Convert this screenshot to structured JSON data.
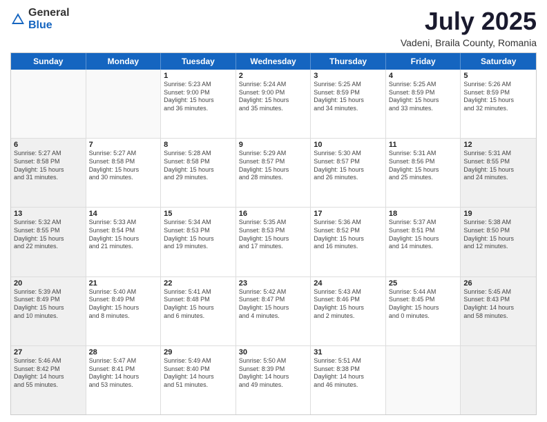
{
  "logo": {
    "general": "General",
    "blue": "Blue"
  },
  "title": "July 2025",
  "subtitle": "Vadeni, Braila County, Romania",
  "header_days": [
    "Sunday",
    "Monday",
    "Tuesday",
    "Wednesday",
    "Thursday",
    "Friday",
    "Saturday"
  ],
  "rows": [
    [
      {
        "day": "",
        "lines": [],
        "empty": true
      },
      {
        "day": "",
        "lines": [],
        "empty": true
      },
      {
        "day": "1",
        "lines": [
          "Sunrise: 5:23 AM",
          "Sunset: 9:00 PM",
          "Daylight: 15 hours",
          "and 36 minutes."
        ]
      },
      {
        "day": "2",
        "lines": [
          "Sunrise: 5:24 AM",
          "Sunset: 9:00 PM",
          "Daylight: 15 hours",
          "and 35 minutes."
        ]
      },
      {
        "day": "3",
        "lines": [
          "Sunrise: 5:25 AM",
          "Sunset: 8:59 PM",
          "Daylight: 15 hours",
          "and 34 minutes."
        ]
      },
      {
        "day": "4",
        "lines": [
          "Sunrise: 5:25 AM",
          "Sunset: 8:59 PM",
          "Daylight: 15 hours",
          "and 33 minutes."
        ]
      },
      {
        "day": "5",
        "lines": [
          "Sunrise: 5:26 AM",
          "Sunset: 8:59 PM",
          "Daylight: 15 hours",
          "and 32 minutes."
        ]
      }
    ],
    [
      {
        "day": "6",
        "lines": [
          "Sunrise: 5:27 AM",
          "Sunset: 8:58 PM",
          "Daylight: 15 hours",
          "and 31 minutes."
        ],
        "shaded": true
      },
      {
        "day": "7",
        "lines": [
          "Sunrise: 5:27 AM",
          "Sunset: 8:58 PM",
          "Daylight: 15 hours",
          "and 30 minutes."
        ]
      },
      {
        "day": "8",
        "lines": [
          "Sunrise: 5:28 AM",
          "Sunset: 8:58 PM",
          "Daylight: 15 hours",
          "and 29 minutes."
        ]
      },
      {
        "day": "9",
        "lines": [
          "Sunrise: 5:29 AM",
          "Sunset: 8:57 PM",
          "Daylight: 15 hours",
          "and 28 minutes."
        ]
      },
      {
        "day": "10",
        "lines": [
          "Sunrise: 5:30 AM",
          "Sunset: 8:57 PM",
          "Daylight: 15 hours",
          "and 26 minutes."
        ]
      },
      {
        "day": "11",
        "lines": [
          "Sunrise: 5:31 AM",
          "Sunset: 8:56 PM",
          "Daylight: 15 hours",
          "and 25 minutes."
        ]
      },
      {
        "day": "12",
        "lines": [
          "Sunrise: 5:31 AM",
          "Sunset: 8:55 PM",
          "Daylight: 15 hours",
          "and 24 minutes."
        ],
        "shaded": true
      }
    ],
    [
      {
        "day": "13",
        "lines": [
          "Sunrise: 5:32 AM",
          "Sunset: 8:55 PM",
          "Daylight: 15 hours",
          "and 22 minutes."
        ],
        "shaded": true
      },
      {
        "day": "14",
        "lines": [
          "Sunrise: 5:33 AM",
          "Sunset: 8:54 PM",
          "Daylight: 15 hours",
          "and 21 minutes."
        ]
      },
      {
        "day": "15",
        "lines": [
          "Sunrise: 5:34 AM",
          "Sunset: 8:53 PM",
          "Daylight: 15 hours",
          "and 19 minutes."
        ]
      },
      {
        "day": "16",
        "lines": [
          "Sunrise: 5:35 AM",
          "Sunset: 8:53 PM",
          "Daylight: 15 hours",
          "and 17 minutes."
        ]
      },
      {
        "day": "17",
        "lines": [
          "Sunrise: 5:36 AM",
          "Sunset: 8:52 PM",
          "Daylight: 15 hours",
          "and 16 minutes."
        ]
      },
      {
        "day": "18",
        "lines": [
          "Sunrise: 5:37 AM",
          "Sunset: 8:51 PM",
          "Daylight: 15 hours",
          "and 14 minutes."
        ]
      },
      {
        "day": "19",
        "lines": [
          "Sunrise: 5:38 AM",
          "Sunset: 8:50 PM",
          "Daylight: 15 hours",
          "and 12 minutes."
        ],
        "shaded": true
      }
    ],
    [
      {
        "day": "20",
        "lines": [
          "Sunrise: 5:39 AM",
          "Sunset: 8:49 PM",
          "Daylight: 15 hours",
          "and 10 minutes."
        ],
        "shaded": true
      },
      {
        "day": "21",
        "lines": [
          "Sunrise: 5:40 AM",
          "Sunset: 8:49 PM",
          "Daylight: 15 hours",
          "and 8 minutes."
        ]
      },
      {
        "day": "22",
        "lines": [
          "Sunrise: 5:41 AM",
          "Sunset: 8:48 PM",
          "Daylight: 15 hours",
          "and 6 minutes."
        ]
      },
      {
        "day": "23",
        "lines": [
          "Sunrise: 5:42 AM",
          "Sunset: 8:47 PM",
          "Daylight: 15 hours",
          "and 4 minutes."
        ]
      },
      {
        "day": "24",
        "lines": [
          "Sunrise: 5:43 AM",
          "Sunset: 8:46 PM",
          "Daylight: 15 hours",
          "and 2 minutes."
        ]
      },
      {
        "day": "25",
        "lines": [
          "Sunrise: 5:44 AM",
          "Sunset: 8:45 PM",
          "Daylight: 15 hours",
          "and 0 minutes."
        ]
      },
      {
        "day": "26",
        "lines": [
          "Sunrise: 5:45 AM",
          "Sunset: 8:43 PM",
          "Daylight: 14 hours",
          "and 58 minutes."
        ],
        "shaded": true
      }
    ],
    [
      {
        "day": "27",
        "lines": [
          "Sunrise: 5:46 AM",
          "Sunset: 8:42 PM",
          "Daylight: 14 hours",
          "and 55 minutes."
        ],
        "shaded": true
      },
      {
        "day": "28",
        "lines": [
          "Sunrise: 5:47 AM",
          "Sunset: 8:41 PM",
          "Daylight: 14 hours",
          "and 53 minutes."
        ]
      },
      {
        "day": "29",
        "lines": [
          "Sunrise: 5:49 AM",
          "Sunset: 8:40 PM",
          "Daylight: 14 hours",
          "and 51 minutes."
        ]
      },
      {
        "day": "30",
        "lines": [
          "Sunrise: 5:50 AM",
          "Sunset: 8:39 PM",
          "Daylight: 14 hours",
          "and 49 minutes."
        ]
      },
      {
        "day": "31",
        "lines": [
          "Sunrise: 5:51 AM",
          "Sunset: 8:38 PM",
          "Daylight: 14 hours",
          "and 46 minutes."
        ]
      },
      {
        "day": "",
        "lines": [],
        "empty": true
      },
      {
        "day": "",
        "lines": [],
        "empty": true,
        "shaded": true
      }
    ]
  ]
}
